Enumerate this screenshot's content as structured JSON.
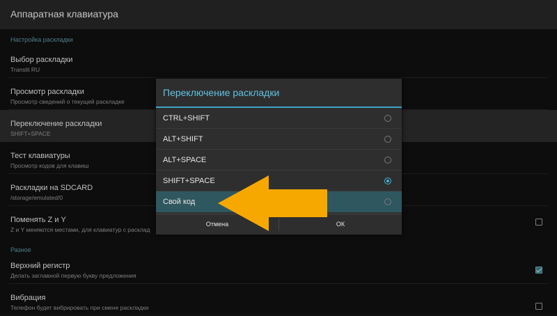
{
  "appbar": {
    "title": "Аппаратная клавиатура"
  },
  "sections": {
    "layout_settings": "Настройка раскладки",
    "misc": "Разное"
  },
  "settings": [
    {
      "title": "Выбор раскладки",
      "subtitle": "Translit RU"
    },
    {
      "title": "Просмотр раскладки",
      "subtitle": "Просмотр сведений о текущей раскладке"
    },
    {
      "title": "Переключение раскладки",
      "subtitle": "SHIFT+SPACE"
    },
    {
      "title": "Тест клавиатуры",
      "subtitle": "Просмотр кодов для клавиш"
    },
    {
      "title": "Раскладки на SDCARD",
      "subtitle": "/storage/emulated/0"
    },
    {
      "title": "Поменять Z и Y",
      "subtitle": "Z и Y меняются местами, для клавиатур с расклад",
      "checked": false
    },
    {
      "title": "Верхний регистр",
      "subtitle": "Делать заглавной первую букву предложения",
      "checked": true
    },
    {
      "title": "Вибрация",
      "subtitle": "Телефон будет вибрировать при смене раскладки",
      "checked": false
    }
  ],
  "dialog": {
    "title": "Переключение раскладки",
    "options": [
      "CTRL+SHIFT",
      "ALT+SHIFT",
      "ALT+SPACE",
      "SHIFT+SPACE",
      "Свой код"
    ],
    "selected_option": "SHIFT+SPACE",
    "highlighted_option": "Свой код",
    "cancel_label": "Отмена",
    "ok_label": "ОК"
  },
  "colors": {
    "accent": "#3fb8e0",
    "annotation_arrow": "#f7a800"
  },
  "icons": {
    "annotation": "arrow-left-icon"
  }
}
